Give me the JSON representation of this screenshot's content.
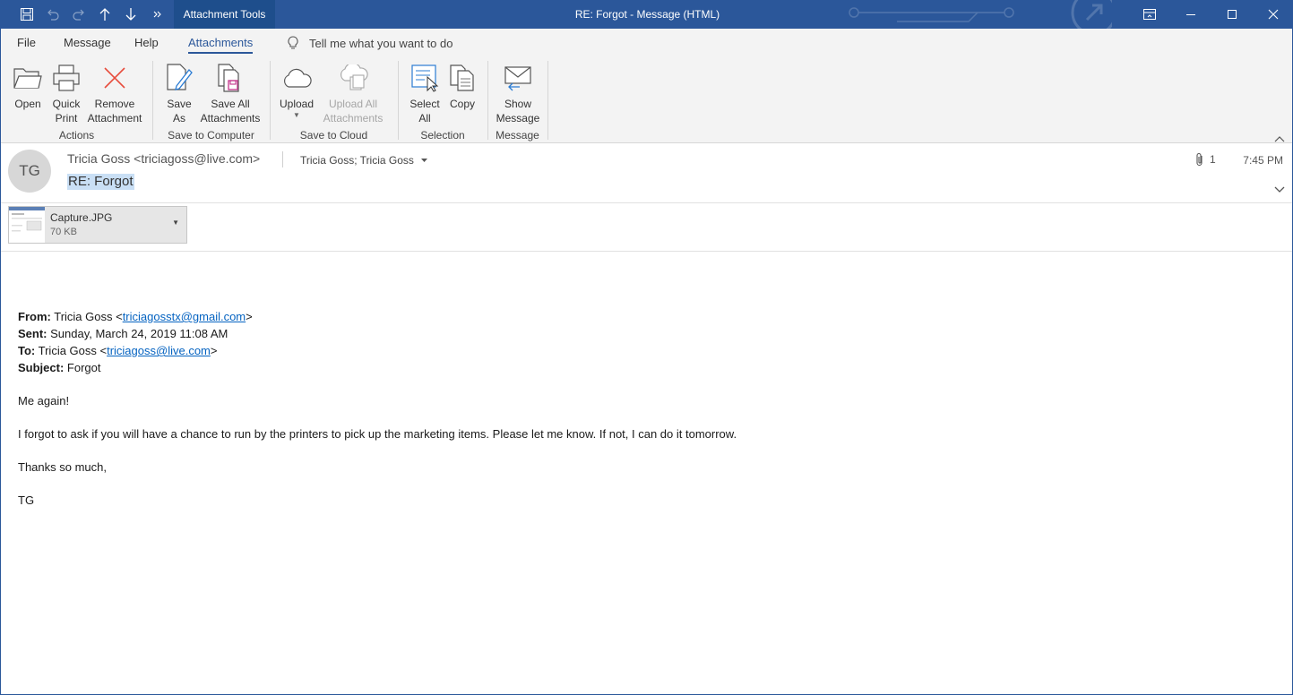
{
  "window": {
    "title": "RE: Forgot  -  Message (HTML)",
    "context_tab": "Attachment Tools"
  },
  "menu": {
    "tabs": [
      "File",
      "Message",
      "Help",
      "Attachments"
    ],
    "active_tab": "Attachments",
    "tell_me": "Tell me what you want to do"
  },
  "ribbon": {
    "open": "Open",
    "quick_print": [
      "Quick",
      "Print"
    ],
    "remove_attachment": [
      "Remove",
      "Attachment"
    ],
    "save_as": [
      "Save",
      "As"
    ],
    "save_all": [
      "Save All",
      "Attachments"
    ],
    "upload": "Upload",
    "upload_all": [
      "Upload All",
      "Attachments"
    ],
    "select_all": [
      "Select",
      "All"
    ],
    "copy": "Copy",
    "show_message": [
      "Show",
      "Message"
    ],
    "groups": {
      "actions": "Actions",
      "save_to_computer": "Save to Computer",
      "save_to_cloud": "Save to Cloud",
      "selection": "Selection",
      "message": "Message"
    }
  },
  "header": {
    "initials": "TG",
    "sender": "Tricia Goss <triciagoss@live.com>",
    "recipients": "Tricia Goss; Tricia Goss",
    "subject": "RE: Forgot",
    "attachment_count": "1",
    "time": "7:45 PM"
  },
  "attachment": {
    "name": "Capture.JPG",
    "size": "70 KB"
  },
  "email": {
    "from_label": "From:",
    "from_name": "Tricia Goss <",
    "from_email": "triciagosstx@gmail.com",
    "from_close": ">",
    "sent_label": "Sent:",
    "sent_value": "Sunday, March 24, 2019 11:08 AM",
    "to_label": "To:",
    "to_name": "Tricia Goss <",
    "to_email": "triciagoss@live.com",
    "to_close": ">",
    "subject_label": "Subject:",
    "subject_value": "Forgot",
    "greeting": "Me again!",
    "body": "I forgot to ask if you will have a chance to run by the printers to pick up the marketing items. Please let me know. If not, I can do it tomorrow.",
    "closing": "Thanks so much,",
    "signature": "TG"
  },
  "colors": {
    "titlebar": "#2b579a",
    "context_tab": "#1e4e8c",
    "link": "#0563c1",
    "subject_highlight": "#c9dff5",
    "remove_icon": "#e74c3c"
  }
}
